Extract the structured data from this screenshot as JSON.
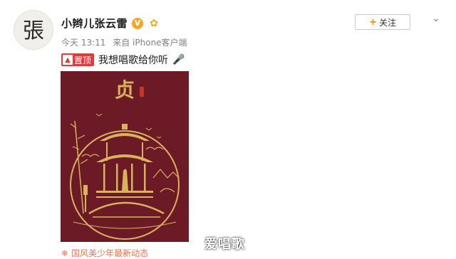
{
  "profile": {
    "avatar_char": "張",
    "username": "小辫儿张云雷",
    "verified_icon": "verified-v-icon",
    "level_icon": "level-badge-icon"
  },
  "meta": {
    "time": "今天 13:11",
    "source": "来自 iPhone客户端"
  },
  "actions": {
    "follow_plus": "+",
    "follow_label": "关注",
    "more_icon": "chevron-down-icon"
  },
  "post": {
    "pin_label": "置顶",
    "text": "我想唱歌给你听",
    "voice_icon": "microphone-icon"
  },
  "poster": {
    "title_char": "贞",
    "background_color": "#6b1a26",
    "accent_color": "#d9b25c"
  },
  "footer": {
    "link_text": "国风美少年最新动态"
  },
  "watermark": {
    "text": "爱唱歌"
  },
  "colors": {
    "accent_orange": "#ff8200",
    "pin_red": "#e4393c",
    "link_orange": "#eb7350"
  }
}
